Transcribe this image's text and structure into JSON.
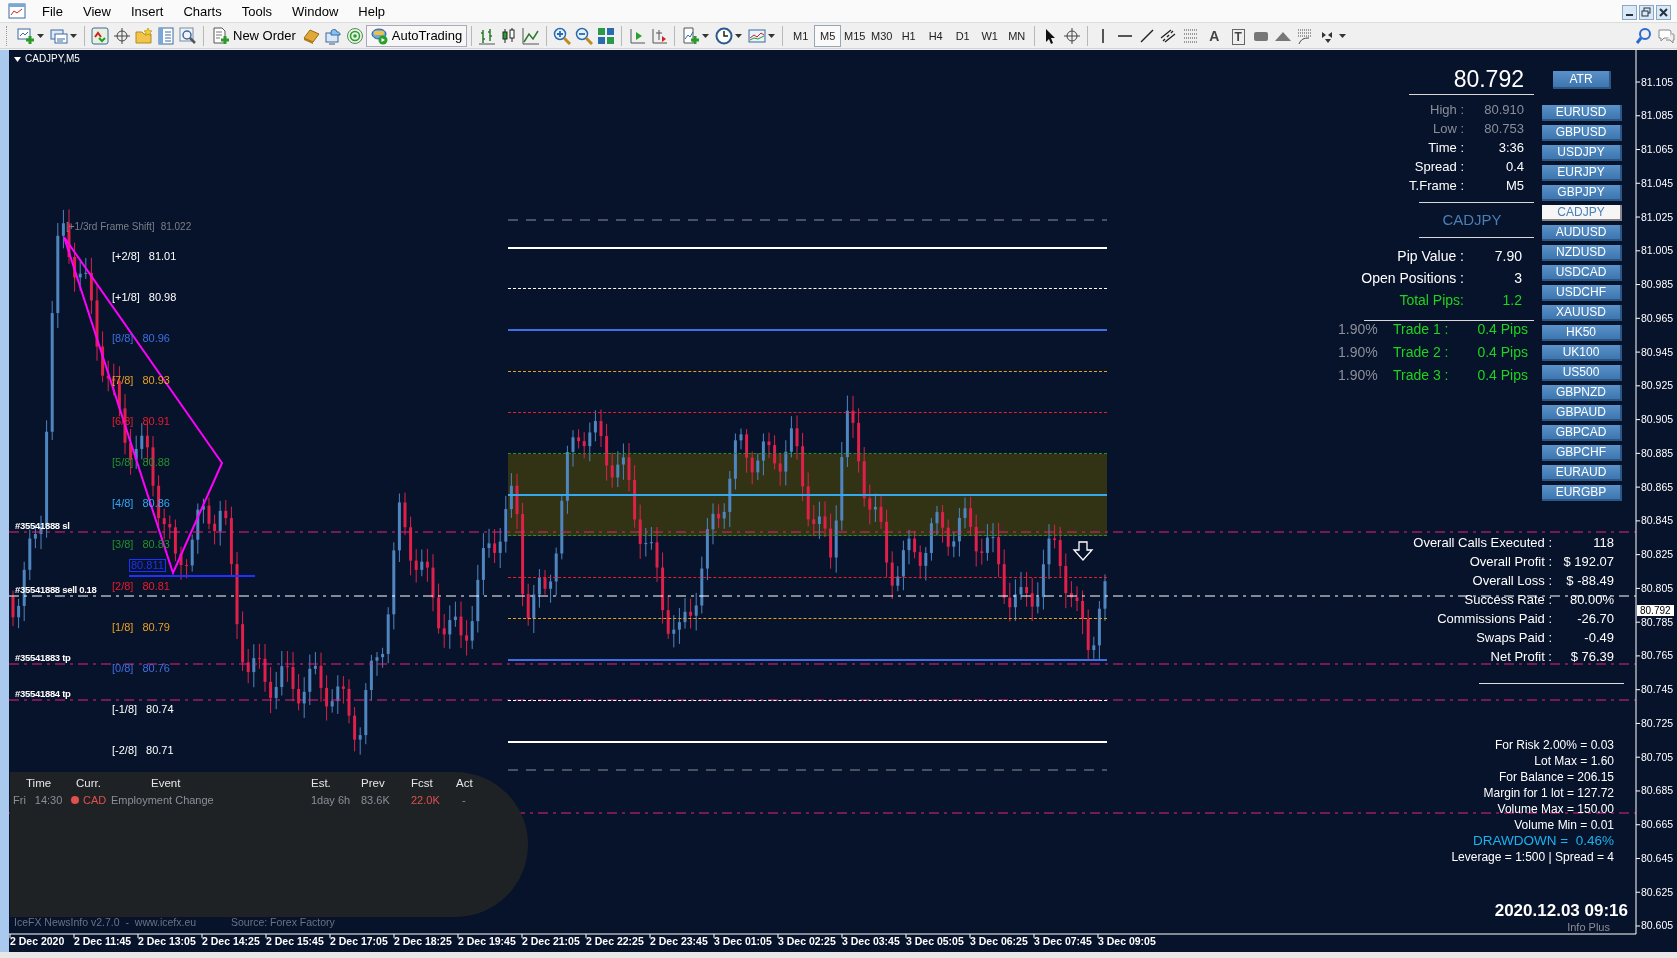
{
  "menu": [
    "File",
    "View",
    "Insert",
    "Charts",
    "Tools",
    "Window",
    "Help"
  ],
  "toolbar": {
    "new_order": "New Order",
    "auto_trading": "AutoTrading",
    "text_tool": "A",
    "label_tool": "T",
    "timeframes": [
      {
        "label": "M1",
        "selected": false
      },
      {
        "label": "M5",
        "selected": true
      },
      {
        "label": "M15",
        "selected": false
      },
      {
        "label": "M30",
        "selected": false
      },
      {
        "label": "H1",
        "selected": false
      },
      {
        "label": "H4",
        "selected": false
      },
      {
        "label": "D1",
        "selected": false
      },
      {
        "label": "W1",
        "selected": false
      },
      {
        "label": "MN",
        "selected": false
      }
    ]
  },
  "chart": {
    "title": "CADJPY,M5",
    "frame_shift": {
      "label": "[+1/3rd Frame Shift]",
      "value": "81.022"
    },
    "murrey_levels": [
      {
        "label": "[+2/8]",
        "value": "81.01",
        "color": "#ffffff",
        "dashed": false
      },
      {
        "label": "[+1/8]",
        "value": "80.98",
        "color": "#ffffff",
        "dashed": true
      },
      {
        "label": "[8/8]",
        "value": "80.96",
        "color": "#3f6fe0",
        "dashed": false
      },
      {
        "label": "[7/8]",
        "value": "80.93",
        "color": "#e8a020",
        "dashed": true
      },
      {
        "label": "[6/8]",
        "value": "80.91",
        "color": "#e81c2c",
        "dashed": true
      },
      {
        "label": "[5/8]",
        "value": "80.88",
        "color": "#23922a",
        "dashed": true
      },
      {
        "label": "[4/8]",
        "value": "80.86",
        "color": "#35a8f0",
        "dashed": false
      },
      {
        "label": "[3/8]",
        "value": "80.83",
        "color": "#23922a",
        "dashed": true
      },
      {
        "label": "[2/8]",
        "value": "80.81",
        "color": "#e81c2c",
        "dashed": true
      },
      {
        "label": "[1/8]",
        "value": "80.79",
        "color": "#e8a020",
        "dashed": true
      },
      {
        "label": "[0/8]",
        "value": "80.76",
        "color": "#3f6fe0",
        "dashed": false
      },
      {
        "label": "[-1/8]",
        "value": "80.74",
        "color": "#ffffff",
        "dashed": true
      },
      {
        "label": "[-2/8]",
        "value": "80.71",
        "color": "#ffffff",
        "dashed": false
      }
    ],
    "orders": [
      {
        "label": "#35541888 sl",
        "kind": "sl"
      },
      {
        "label": "#35541888 sell 0.18",
        "kind": "entry"
      },
      {
        "label": "#35541883 tp",
        "kind": "tp"
      },
      {
        "label": "#35541884 tp",
        "kind": "tp"
      }
    ],
    "pivot_label": "80.811",
    "price_axis": [
      "81.105",
      "81.085",
      "81.065",
      "81.045",
      "81.025",
      "81.005",
      "80.985",
      "80.965",
      "80.945",
      "80.925",
      "80.905",
      "80.885",
      "80.865",
      "80.845",
      "80.825",
      "80.805",
      "80.785",
      "80.765",
      "80.745",
      "80.725",
      "80.705",
      "80.685",
      "80.665",
      "80.645",
      "80.625",
      "80.605"
    ],
    "current_price": "80.792",
    "time_axis": [
      "2 Dec 2020",
      "2 Dec 11:45",
      "2 Dec 13:05",
      "2 Dec 14:25",
      "2 Dec 15:45",
      "2 Dec 17:05",
      "2 Dec 18:25",
      "2 Dec 19:45",
      "2 Dec 21:05",
      "2 Dec 22:25",
      "2 Dec 23:45",
      "3 Dec 01:05",
      "3 Dec 02:25",
      "3 Dec 03:45",
      "3 Dec 05:05",
      "3 Dec 06:25",
      "3 Dec 07:45",
      "3 Dec 09:05"
    ]
  },
  "info_panel": {
    "price": "80.792",
    "atr_button": "ATR",
    "symbols": [
      {
        "label": "EURUSD",
        "selected": false
      },
      {
        "label": "GBPUSD",
        "selected": false
      },
      {
        "label": "USDJPY",
        "selected": false
      },
      {
        "label": "EURJPY",
        "selected": false
      },
      {
        "label": "GBPJPY",
        "selected": false
      },
      {
        "label": "CADJPY",
        "selected": true
      },
      {
        "label": "AUDUSD",
        "selected": false
      },
      {
        "label": "NZDUSD",
        "selected": false
      },
      {
        "label": "USDCAD",
        "selected": false
      },
      {
        "label": "USDCHF",
        "selected": false
      },
      {
        "label": "XAUUSD",
        "selected": false
      },
      {
        "label": "HK50",
        "selected": false
      },
      {
        "label": "UK100",
        "selected": false
      },
      {
        "label": "US500",
        "selected": false
      },
      {
        "label": "GBPNZD",
        "selected": false
      },
      {
        "label": "GBPAUD",
        "selected": false
      },
      {
        "label": "GBPCAD",
        "selected": false
      },
      {
        "label": "GBPCHF",
        "selected": false
      },
      {
        "label": "EURAUD",
        "selected": false
      },
      {
        "label": "EURGBP",
        "selected": false
      }
    ],
    "quote_stats": [
      {
        "label": "High :",
        "value": "80.910",
        "kind": "muted"
      },
      {
        "label": "Low :",
        "value": "80.753",
        "kind": "muted"
      },
      {
        "label": "Time :",
        "value": "3:36",
        "kind": "normal"
      },
      {
        "label": "Spread :",
        "value": "0.4",
        "kind": "normal"
      },
      {
        "label": "T.Frame :",
        "value": "M5",
        "kind": "normal"
      }
    ],
    "symbol": "CADJPY",
    "position_stats": [
      {
        "label": "Pip Value :",
        "value": "7.90",
        "kind": "normal"
      },
      {
        "label": "Open Positions :",
        "value": "3",
        "kind": "normal"
      },
      {
        "label": "Total Pips:",
        "value": "1.2",
        "kind": "profit"
      }
    ],
    "trades": [
      {
        "risk": "1.90%",
        "label": "Trade 1 :",
        "value": "0.4 Pips"
      },
      {
        "risk": "1.90%",
        "label": "Trade 2 :",
        "value": "0.4 Pips"
      },
      {
        "risk": "1.90%",
        "label": "Trade 3 :",
        "value": "0.4 Pips"
      }
    ]
  },
  "account_stats": [
    {
      "label": "Overall Calls Executed :",
      "value": "118"
    },
    {
      "label": "Overall Profit :",
      "value": "$ 192.07"
    },
    {
      "label": "Overall Loss :",
      "value": "$ -88.49"
    },
    {
      "label": "Success Rate :",
      "value": "80.00%"
    },
    {
      "label": "Commissions Paid :",
      "value": "-26.70"
    },
    {
      "label": "Swaps Paid :",
      "value": "-0.49"
    },
    {
      "label": "Net Profit :",
      "value": "$ 76.39"
    }
  ],
  "risk_info": [
    {
      "text": "For Risk 2.00% = 0.03",
      "kind": "normal"
    },
    {
      "text": "Lot Max = 1.60",
      "kind": "normal"
    },
    {
      "text": "For Balance = 206.15",
      "kind": "normal"
    },
    {
      "text": "Margin for 1 lot = 127.72",
      "kind": "normal"
    },
    {
      "text": "Volume Max = 150.00",
      "kind": "normal"
    },
    {
      "text": "Volume Min = 0.01",
      "kind": "normal"
    },
    {
      "text": "DRAWDOWN =  0.46%",
      "kind": "alert"
    },
    {
      "text": "Leverage = 1:500 | Spread = 4",
      "kind": "normal"
    }
  ],
  "timestamp": "2020.12.03 09:16",
  "timestamp_caption": "Info Plus",
  "news": {
    "columns": [
      "Time",
      "Curr.",
      "Event",
      "Est.",
      "Prev",
      "Fcst",
      "Act"
    ],
    "rows": [
      {
        "day": "Fri",
        "time": "14:30",
        "currency": "CAD",
        "color": "#e05050",
        "event": "Employment Change",
        "est": "1day 6h",
        "prev": "83.6K",
        "fcst": "22.0K",
        "act": "-"
      }
    ],
    "credit": "IceFX NewsInfo v2.7.0  -  www.icefx.eu",
    "source": "Source: Forex Factory"
  }
}
